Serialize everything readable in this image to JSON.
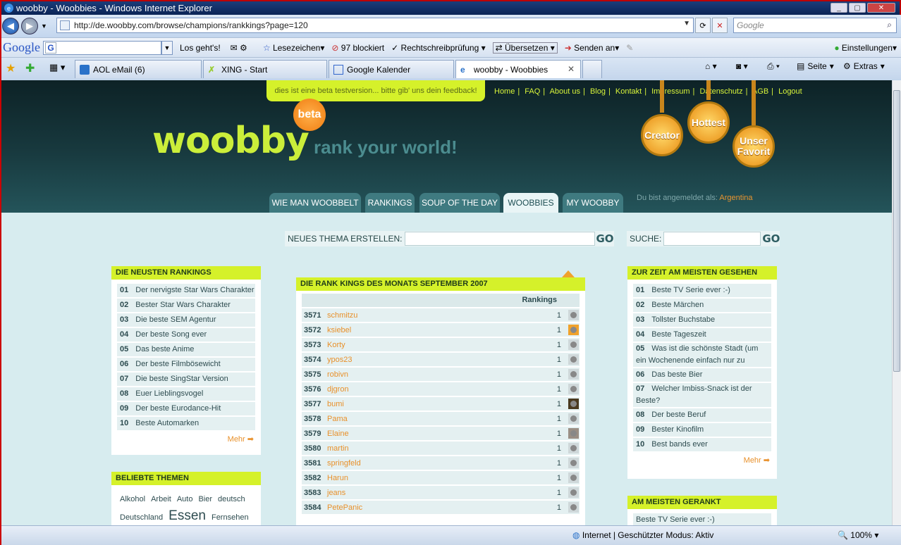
{
  "window": {
    "title": "woobby - Woobbies - Windows Internet Explorer"
  },
  "address": {
    "url": "http://de.woobby.com/browse/champions/rankkings?page=120"
  },
  "search": {
    "placeholder": "Google"
  },
  "googlebar": {
    "go": "Los geht's!",
    "bookmarks": "Lesezeichen",
    "blocked": "97 blockiert",
    "spell": "Rechtschreibprüfung",
    "translate": "Übersetzen",
    "send": "Senden an",
    "settings": "Einstellungen"
  },
  "tabs": [
    {
      "label": "AOL eMail (6)"
    },
    {
      "label": "XING - Start"
    },
    {
      "label": "Google Kalender"
    },
    {
      "label": "woobby - Woobbies"
    }
  ],
  "commands": {
    "page": "Seite",
    "extras": "Extras"
  },
  "site": {
    "beta_notice": "dies ist eine beta testversion... bitte gib' uns dein feedback!",
    "toplinks": [
      "Home",
      "FAQ",
      "About us",
      "Blog",
      "Kontakt",
      "Impressum",
      "Datenschutz",
      "AGB",
      "Logout"
    ],
    "logo": "woobby",
    "beta": "beta",
    "slogan": "rank your world!",
    "medals": [
      "Creator",
      "Hottest",
      "Unser Favorit"
    ],
    "nav": [
      "WIE MAN WOOBBELT",
      "RANKINGS",
      "SOUP OF THE DAY",
      "WOOBBIES",
      "MY WOOBBY"
    ],
    "logged_in_label": "Du bist angemeldet als:",
    "user": "Argentina",
    "new_topic_label": "NEUES THEMA ERSTELLEN:",
    "search_label": "SUCHE:",
    "go": "GO"
  },
  "newest": {
    "title": "DIE NEUSTEN RANKINGS",
    "more": "Mehr",
    "items": [
      {
        "n": "01",
        "t": "Der nervigste Star Wars Charakter"
      },
      {
        "n": "02",
        "t": "Bester Star Wars Charakter"
      },
      {
        "n": "03",
        "t": "Die beste SEM Agentur"
      },
      {
        "n": "04",
        "t": "Der beste Song ever"
      },
      {
        "n": "05",
        "t": "Das beste Anime"
      },
      {
        "n": "06",
        "t": "Der beste Filmbösewicht"
      },
      {
        "n": "07",
        "t": "Die beste SingStar Version"
      },
      {
        "n": "08",
        "t": "Euer Lieblingsvogel"
      },
      {
        "n": "09",
        "t": "Der beste Eurodance-Hit"
      },
      {
        "n": "10",
        "t": "Beste Automarken"
      }
    ]
  },
  "popular": {
    "title": "BELIEBTE THEMEN",
    "tags": [
      "Alkohol",
      "Arbeit",
      "Auto",
      "Bier",
      "deutsch",
      "Deutschland",
      "Essen",
      "Fernsehen"
    ]
  },
  "rankkings": {
    "title": "DIE RANK KINGS DES MONATS SEPTEMBER 2007",
    "col": "Rankings",
    "rows": [
      {
        "r": "3571",
        "u": "schmitzu",
        "c": "1"
      },
      {
        "r": "3572",
        "u": "ksiebel",
        "c": "1"
      },
      {
        "r": "3573",
        "u": "Korty",
        "c": "1"
      },
      {
        "r": "3574",
        "u": "ypos23",
        "c": "1"
      },
      {
        "r": "3575",
        "u": "robivn",
        "c": "1"
      },
      {
        "r": "3576",
        "u": "djgron",
        "c": "1"
      },
      {
        "r": "3577",
        "u": "bumi",
        "c": "1"
      },
      {
        "r": "3578",
        "u": "Pama",
        "c": "1"
      },
      {
        "r": "3579",
        "u": "Elaine",
        "c": "1"
      },
      {
        "r": "3580",
        "u": "martin",
        "c": "1"
      },
      {
        "r": "3581",
        "u": "springfeld",
        "c": "1"
      },
      {
        "r": "3582",
        "u": "Harun",
        "c": "1"
      },
      {
        "r": "3583",
        "u": "jeans",
        "c": "1"
      },
      {
        "r": "3584",
        "u": "PetePanic",
        "c": "1"
      }
    ]
  },
  "mostseen": {
    "title": "ZUR ZEIT AM MEISTEN GESEHEN",
    "more": "Mehr",
    "items": [
      {
        "n": "01",
        "t": "Beste TV Serie ever :-)"
      },
      {
        "n": "02",
        "t": "Beste Märchen"
      },
      {
        "n": "03",
        "t": "Tollster Buchstabe"
      },
      {
        "n": "04",
        "t": "Beste Tageszeit"
      },
      {
        "n": "05",
        "t": "Was ist die schönste Stadt (um ein Wochenende einfach nur zu genießen)"
      },
      {
        "n": "06",
        "t": "Das beste Bier"
      },
      {
        "n": "07",
        "t": "Welcher Imbiss-Snack ist der Beste?"
      },
      {
        "n": "08",
        "t": "Der beste Beruf"
      },
      {
        "n": "09",
        "t": "Bester Kinofilm"
      },
      {
        "n": "10",
        "t": "Best bands ever"
      }
    ]
  },
  "mostranked": {
    "title": "AM MEISTEN GERANKT",
    "first": "Beste TV Serie ever :-)"
  },
  "status": {
    "zone": "Internet | Geschützter Modus: Aktiv",
    "zoom": "100%"
  }
}
